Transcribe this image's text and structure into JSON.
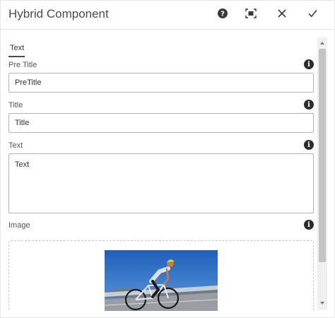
{
  "dialog": {
    "title": "Hybrid Component",
    "help_icon": "help-icon",
    "fullscreen_icon": "fullscreen-icon",
    "close_icon": "close-icon",
    "done_icon": "checkmark-icon"
  },
  "tabs": [
    {
      "label": "Text",
      "active": true
    }
  ],
  "fields": {
    "pretitle": {
      "label": "Pre Title",
      "value": "PreTitle"
    },
    "title": {
      "label": "Title",
      "value": "Title"
    },
    "text": {
      "label": "Text",
      "value": "Text"
    },
    "image": {
      "label": "Image"
    }
  },
  "colors": {
    "accent": "#2c2c2c",
    "border": "#b4b4b4"
  }
}
